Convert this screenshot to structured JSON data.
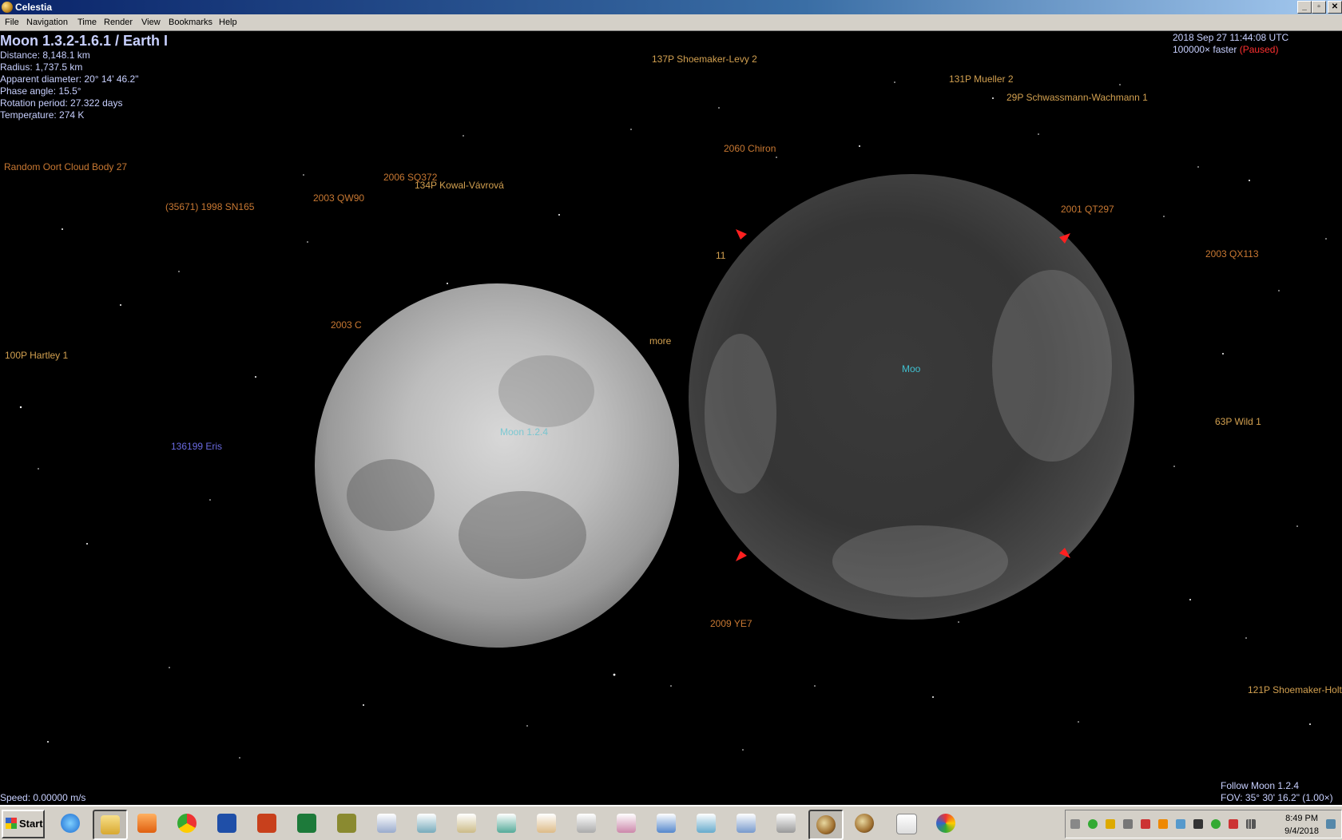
{
  "window": {
    "title": "Celestia",
    "controls": [
      "_",
      "▫",
      "✕"
    ]
  },
  "menu": [
    "File",
    "Navigation",
    "Time",
    "Render",
    "View",
    "Bookmarks",
    "Help"
  ],
  "info": {
    "object_name": "Moon 1.3.2-1.6.1 / Earth I",
    "distance": "Distance: 8,148.1 km",
    "radius": "Radius: 1,737.5 km",
    "apparent_diameter": "Apparent diameter: 20° 14' 46.2\"",
    "phase_angle": "Phase angle: 15.5°",
    "rotation_period": "Rotation period: 27.322 days",
    "temperature": "Temperature: 274 K"
  },
  "time": {
    "datetime": "2018 Sep 27 11:44:08 UTC",
    "rate": "100000× faster",
    "paused": "(Paused)"
  },
  "labels": {
    "l1": "137P Shoemaker-Levy 2",
    "l2": "131P Mueller 2",
    "l3": "29P Schwassmann-Wachmann 1",
    "l4": "2060 Chiron",
    "l5": "Random Oort Cloud Body 27",
    "l6": "2006 SQ372",
    "l7": "134P Kowal-Vávrová",
    "l8": "2003 QW90",
    "l9": "(35671) 1998 SN165",
    "l10": "2001 QT297",
    "l11": "2003 QX113",
    "l12": "11",
    "l13": "2003 C",
    "l14": "more",
    "l15": "100P Hartley 1",
    "l16": "Moo",
    "l17": "Moon 1.2.4",
    "l18": "136199 Eris",
    "l19": "63P Wild 1",
    "l20": "2009 YE7",
    "l21": "121P Shoemaker-Holt"
  },
  "status": {
    "speed": "Speed: 0.00000 m/s",
    "follow": "Follow Moon 1.2.4",
    "fov": "FOV: 35° 30' 16.2\" (1.00×)"
  },
  "taskbar": {
    "start_label": "Start",
    "apps": [
      "internet-explorer-icon",
      "file-explorer-icon",
      "media-player-icon",
      "chrome-icon",
      "word-icon",
      "powerpoint-icon",
      "excel-icon",
      "publisher-icon",
      "document-icon",
      "spreadsheet-icon",
      "network-icon",
      "editor-icon",
      "mail-icon",
      "clock-app-icon",
      "paint-doc-icon",
      "word-doc-icon",
      "tools-icon",
      "chart-doc-icon",
      "settings-doc-icon",
      "celestia-icon",
      "celestia-icon-2",
      "notepad-icon",
      "paint-icon"
    ],
    "clock_time": "8:49 PM",
    "clock_date": "9/4/2018"
  },
  "colors": {
    "label_orange": "#c87832",
    "label_comet": "#d2a050",
    "label_blue": "#6a6ae0",
    "label_cyan": "#40c0d0",
    "info_text": "#c8d0ff",
    "paused": "#ff3030",
    "marker": "#ff2020"
  }
}
